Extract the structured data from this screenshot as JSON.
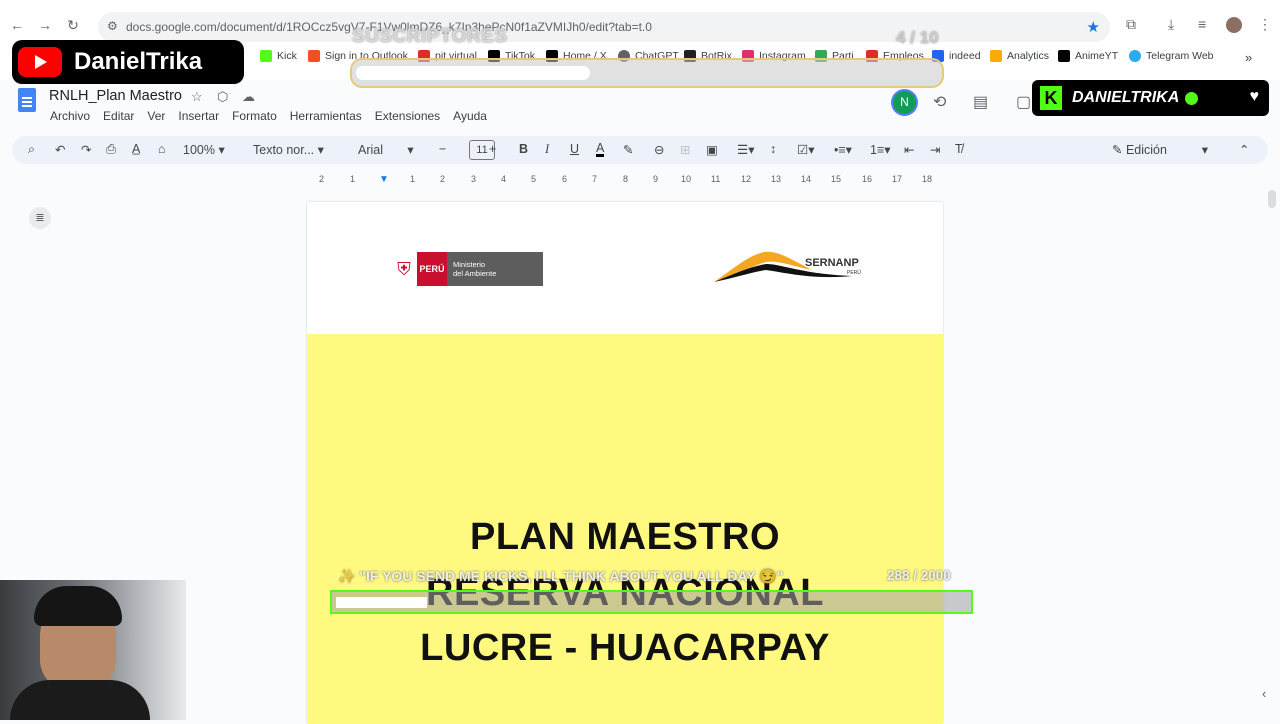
{
  "browser": {
    "url": "docs.google.com/document/d/1ROCcz5vgV7-F1Vw0lmDZ6_k7In3hePcN0f1aZVMIJh0/edit?tab=t.0",
    "bookmarks": [
      {
        "label": "Kick",
        "color": "#53fc18"
      },
      {
        "label": "Sign in to Outlook",
        "color": "#f25022"
      },
      {
        "label": "pit virtual",
        "color": "#d93025"
      },
      {
        "label": "TikTok",
        "color": "#000000"
      },
      {
        "label": "Home / X",
        "color": "#000000"
      },
      {
        "label": "ChatGPT",
        "color": "#5f6368"
      },
      {
        "label": "BotRix",
        "color": "#202124"
      },
      {
        "label": "Instagram",
        "color": "#e1306c"
      },
      {
        "label": "Parti",
        "color": "#34a853"
      },
      {
        "label": "Empleos",
        "color": "#d93025"
      },
      {
        "label": "indeed",
        "color": "#2164f3"
      },
      {
        "label": "Analytics",
        "color": "#f9ab00"
      },
      {
        "label": "AnimeYT",
        "color": "#000000"
      },
      {
        "label": "Telegram Web",
        "color": "#2aabee"
      }
    ]
  },
  "docs": {
    "title": "RNLH_Plan Maestro",
    "menu": [
      "Archivo",
      "Editar",
      "Ver",
      "Insertar",
      "Formato",
      "Herramientas",
      "Extensiones",
      "Ayuda"
    ],
    "avatar_initial": "N",
    "toolbar": {
      "zoom": "100%",
      "style": "Texto nor...",
      "font": "Arial",
      "font_size": "11",
      "mode": "Edición"
    },
    "ruler_ticks": [
      "2",
      "1",
      "1",
      "2",
      "3",
      "4",
      "5",
      "6",
      "7",
      "8",
      "9",
      "10",
      "11",
      "12",
      "13",
      "14",
      "15",
      "16",
      "17",
      "18"
    ]
  },
  "document": {
    "logo_ministry_country": "PERÚ",
    "logo_ministry_name_1": "Ministerio",
    "logo_ministry_name_2": "del Ambiente",
    "logo_sernanp": "SERNANP",
    "logo_sernanp_sub": "PERÚ",
    "cover_line_1": "PLAN MAESTRO",
    "cover_line_2": "RESERVA NACIONAL",
    "cover_line_3": "LUCRE - HUACARPAY",
    "cover_color": "#fff97f"
  },
  "overlays": {
    "yt_channel": "DanielTrika",
    "kick_channel": "DANIELTRIKA",
    "subs_label": "SUSCRIPTORES",
    "subs_count": "4 / 10",
    "subs_progress": 0.4,
    "kicks_message": "\"IF YOU SEND ME KICKS, I'LL THINK ABOUT YOU ALL DAY 😏\"",
    "kicks_count": "288 / 2000",
    "kicks_progress": 0.144
  }
}
